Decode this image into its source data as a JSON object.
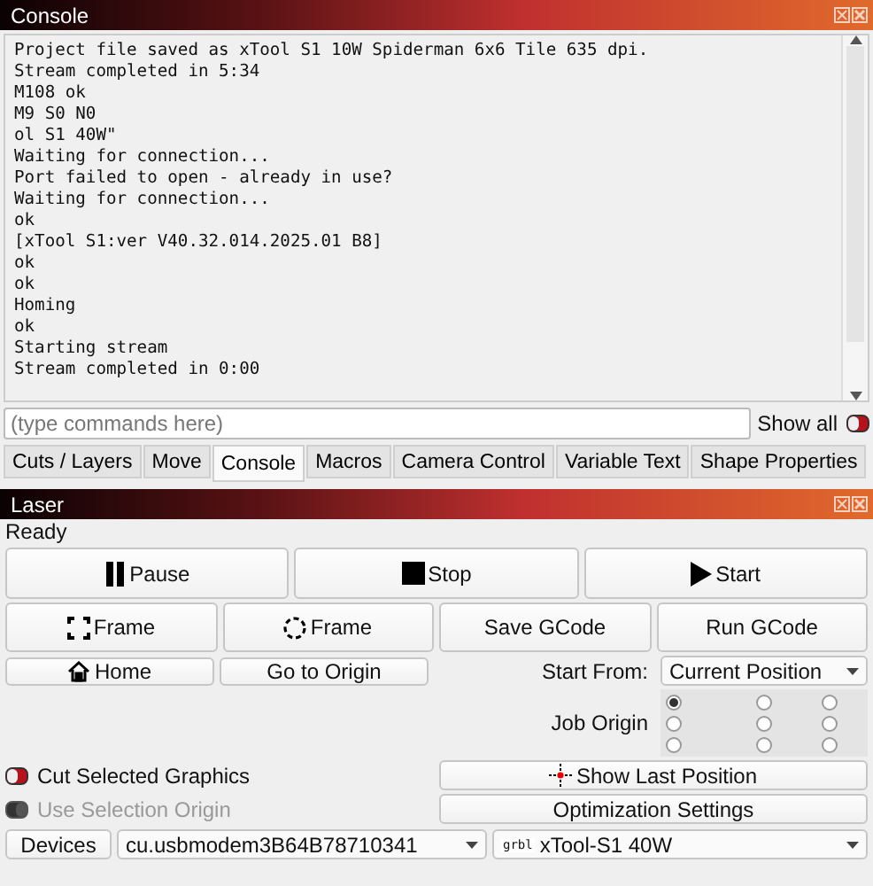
{
  "console": {
    "title": "Console",
    "lines": [
      "Project file saved as xTool S1 10W Spiderman 6x6 Tile 635 dpi.",
      "Stream completed in 5:34",
      "M108 ok",
      "M9 S0 N0",
      "ol S1 40W\"",
      "Waiting for connection...",
      "Port failed to open - already in use?",
      "Waiting for connection...",
      "ok",
      "[xTool S1:ver V40.32.014.2025.01 B8]",
      "ok",
      "ok",
      "Homing",
      "ok",
      "Starting stream",
      "Stream completed in 0:00"
    ],
    "command": {
      "placeholder": "(type commands here)"
    },
    "show_all": {
      "label": "Show all",
      "on": true
    }
  },
  "tabs": [
    {
      "label": "Cuts / Layers",
      "selected": false
    },
    {
      "label": "Move",
      "selected": false
    },
    {
      "label": "Console",
      "selected": true
    },
    {
      "label": "Macros",
      "selected": false
    },
    {
      "label": "Camera Control",
      "selected": false
    },
    {
      "label": "Variable Text",
      "selected": false
    },
    {
      "label": "Shape Properties",
      "selected": false
    }
  ],
  "laser": {
    "title": "Laser",
    "status": "Ready",
    "run_buttons": [
      {
        "label": "Pause",
        "kind": "pause"
      },
      {
        "label": "Stop",
        "kind": "stop"
      },
      {
        "label": "Start",
        "kind": "play"
      }
    ],
    "frame_buttons": [
      {
        "label": "Frame",
        "kind": "framerect"
      },
      {
        "label": "Frame",
        "kind": "framecircle"
      },
      {
        "label": "Save GCode",
        "kind": "plain"
      },
      {
        "label": "Run GCode",
        "kind": "plain"
      }
    ],
    "move_buttons": [
      {
        "label": "Home",
        "kind": "home"
      },
      {
        "label": "Go to Origin",
        "kind": "plain"
      }
    ],
    "start_from": {
      "label": "Start From:",
      "value": "Current Position"
    },
    "job_origin": {
      "label": "Job Origin",
      "positions": [
        {
          "selected": true
        },
        {
          "selected": false
        },
        {
          "selected": false
        },
        {
          "selected": false
        },
        {
          "selected": false
        },
        {
          "selected": false
        },
        {
          "selected": false
        },
        {
          "selected": false
        },
        {
          "selected": false
        }
      ]
    },
    "toggles": [
      {
        "label": "Cut Selected Graphics",
        "on": true,
        "disabled": false
      },
      {
        "label": "Use Selection Origin",
        "on": false,
        "disabled": true
      }
    ],
    "side_buttons": [
      {
        "label": "Show Last Position",
        "kind": "crosshair"
      },
      {
        "label": "Optimization Settings",
        "kind": "plain"
      }
    ],
    "devices_button": "Devices",
    "port": {
      "value": "cu.usbmodem3B64B78710341"
    },
    "device": {
      "badge": "grbl",
      "value": "xTool-S1 40W"
    }
  }
}
